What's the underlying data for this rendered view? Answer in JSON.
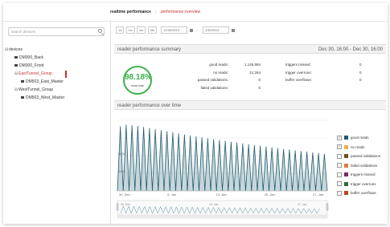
{
  "nav": {
    "active": "realtime performance",
    "separator": "|",
    "link": "performance overview"
  },
  "sidebar": {
    "search_placeholder": "search devices",
    "tree": [
      {
        "label": "devices",
        "level": 0,
        "expander": "⊟"
      },
      {
        "label": "DM300_Back",
        "level": 1,
        "icon": "device-icon"
      },
      {
        "label": "DM300_Front",
        "level": 1,
        "icon": "device-icon"
      },
      {
        "label": "EastTunnel_Group",
        "level": 1,
        "expander": "⊟",
        "selected": true
      },
      {
        "label": "DM503_East_Master",
        "level": 2,
        "icon": "device-icon"
      },
      {
        "label": "WestTunnel_Group",
        "level": 1,
        "expander": "⊟"
      },
      {
        "label": "DM503_West_Master",
        "level": 2,
        "icon": "device-icon"
      }
    ]
  },
  "toolbar": {
    "range_buttons": [
      "1d",
      "1w",
      "1m",
      "3m"
    ],
    "start_date": "12/30/2013",
    "range_sep": "–",
    "end_date": "1/30/2014"
  },
  "summary": {
    "title": "reader performance summary",
    "date_range": "Dec 30, 16:00 - Dec 30, 16:00",
    "read_rate": "98.18%",
    "read_rate_value": 98.18,
    "read_rate_label": "read rate",
    "stats_left": [
      {
        "label": "good reads:",
        "value": "1,145,984"
      },
      {
        "label": "no reads:",
        "value": "21,264"
      },
      {
        "label": "passed validations:",
        "value": "0"
      },
      {
        "label": "failed validations:",
        "value": "0"
      }
    ],
    "stats_right": [
      {
        "label": "triggers missed:",
        "value": "0"
      },
      {
        "label": "trigger overruns:",
        "value": "0"
      },
      {
        "label": "buffer overflows:",
        "value": "0"
      }
    ]
  },
  "time_panel": {
    "title": "reader performance over time"
  },
  "legend": [
    {
      "label": "good reads",
      "checked": true,
      "color": "#1f5c6e"
    },
    {
      "label": "no reads",
      "checked": true,
      "color": "#f0ad4e"
    },
    {
      "label": "passed validations",
      "checked": false,
      "color": "#6b4f2a"
    },
    {
      "label": "failed validations",
      "checked": false,
      "color": "#e07a3f"
    },
    {
      "label": "triggers missed",
      "checked": false,
      "color": "#7a2b5e"
    },
    {
      "label": "trigger overruns",
      "checked": false,
      "color": "#2e6b3a"
    },
    {
      "label": "buffer overflows",
      "checked": false,
      "color": "#c0451f"
    }
  ],
  "chart_data": {
    "type": "area",
    "x_ticks": [
      "30. Dec",
      "6. Jan",
      "13. Jan",
      "20. Jan",
      "27. Jan"
    ],
    "navigator_ticks": [
      "30. Dec",
      "13. Jan",
      "27. Jan"
    ],
    "y_ticks": [
      "500k",
      "250k"
    ],
    "ylim": [
      0,
      1000000
    ],
    "grid": true,
    "series": [
      {
        "name": "good reads",
        "color": "#1f5c6e",
        "peaks": [
          910000,
          935000,
          925000,
          915000,
          900000,
          885000,
          870000,
          855000,
          840000,
          825000,
          810000,
          795000,
          780000,
          765000,
          752000,
          740000,
          728000,
          716000,
          704000,
          692000,
          680000,
          668000,
          656000,
          645000,
          634000,
          623000,
          612000,
          601000,
          590000,
          580000,
          570000,
          560000,
          550000,
          540000,
          530000,
          520000
        ]
      }
    ]
  }
}
